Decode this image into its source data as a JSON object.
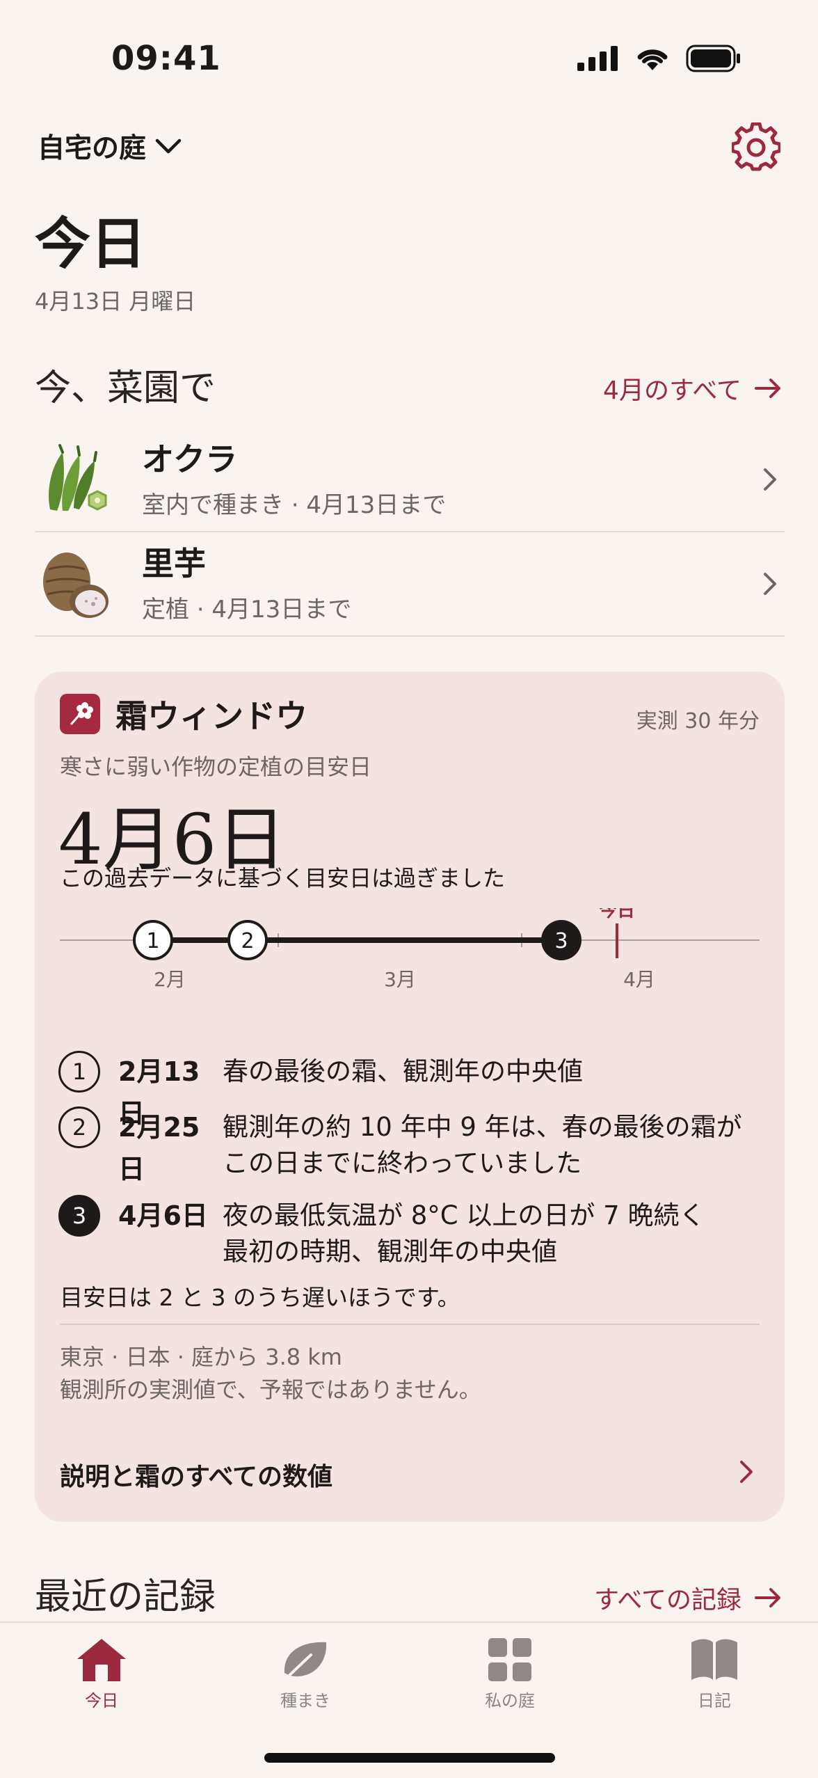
{
  "status_bar": {
    "time": "09:41"
  },
  "header": {
    "garden_name": "自宅の庭",
    "title": "今日",
    "date": "4月13日 月曜日"
  },
  "now_section": {
    "heading": "今、菜園で",
    "link": "4月のすべて",
    "tasks": [
      {
        "name": "オクラ",
        "subtitle": "室内で種まき · 4月13日まで"
      },
      {
        "name": "里芋",
        "subtitle": "定植 · 4月13日まで"
      }
    ]
  },
  "frost_card": {
    "title": "霜ウィンドウ",
    "meta": "実測 30 年分",
    "label": "寒さに弱い作物の定植の目安日",
    "big_date": "4月6日",
    "note": "この過去データに基づく目安日は過ぎました",
    "timeline": {
      "today_label": "今日",
      "months": [
        "2月",
        "3月",
        "4月"
      ],
      "markers": [
        "1",
        "2",
        "3"
      ]
    },
    "legend": [
      {
        "num": "1",
        "date": "2月13日",
        "desc": "春の最後の霜、観測年の中央値",
        "desc2": ""
      },
      {
        "num": "2",
        "date": "2月25日",
        "desc": "観測年の約 10 年中 9 年は、春の最後の霜が",
        "desc2": "この日までに終わっていました"
      },
      {
        "num": "3",
        "date": "4月6日",
        "desc": "夜の最低気温が 8°C 以上の日が 7 晩続く",
        "desc2": "最初の時期、観測年の中央値"
      }
    ],
    "summary": "目安日は 2 と 3 のうち遅いほうです。",
    "location": "東京 · 日本 · 庭から 3.8 km",
    "disclaimer": "観測所の実測値で、予報ではありません。",
    "details_link": "説明と霜のすべての数値"
  },
  "recent_section": {
    "heading": "最近の記録",
    "link": "すべての記録"
  },
  "tabbar": {
    "tabs": [
      {
        "label": "今日",
        "icon": "home-icon",
        "active": true
      },
      {
        "label": "種まき",
        "icon": "leaf-icon",
        "active": false
      },
      {
        "label": "私の庭",
        "icon": "grid-icon",
        "active": false
      },
      {
        "label": "日記",
        "icon": "book-icon",
        "active": false
      }
    ]
  },
  "colors": {
    "accent": "#9c2a3f",
    "background": "#f9f4f0",
    "card": "#f3e4e2",
    "text": "#1f1a1a",
    "muted": "#6d6664"
  }
}
